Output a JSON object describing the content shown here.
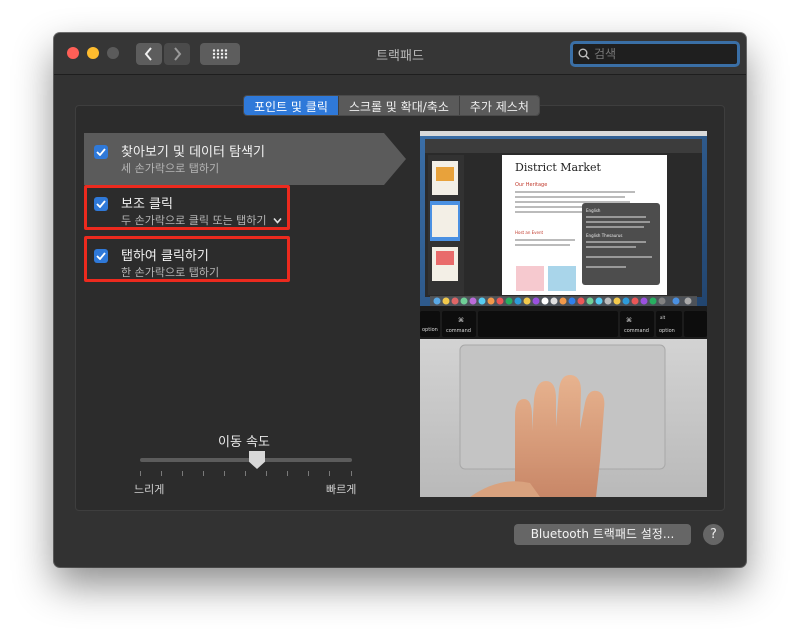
{
  "window": {
    "title": "트랙패드",
    "search_placeholder": "검색"
  },
  "tabs": [
    {
      "label": "포인트 및 클릭",
      "active": true
    },
    {
      "label": "스크롤 및 확대/축소",
      "active": false
    },
    {
      "label": "추가 제스처",
      "active": false
    }
  ],
  "options": [
    {
      "title": "찾아보기 및 데이터 탐색기",
      "subtitle": "세 손가락으로 탭하기",
      "checked": true
    },
    {
      "title": "보조 클릭",
      "subtitle": "두 손가락으로 클릭 또는 탭하기",
      "checked": true,
      "has_dropdown": true
    },
    {
      "title": "탭하여 클릭하기",
      "subtitle": "한 손가락으로 탭하기",
      "checked": true
    }
  ],
  "tracking_speed": {
    "label": "이동 속도",
    "min_label": "느리게",
    "max_label": "빠르게",
    "value_fraction": 0.5
  },
  "preview": {
    "doc_title": "District Market",
    "doc_section1": "Our Heritage",
    "doc_section2": "Host an Event",
    "popup_heading": "English",
    "popup_sub": "English Thesaurus",
    "key_option": "option",
    "key_command": "command",
    "key_cmd_symbol": "⌘",
    "key_alt": "alt"
  },
  "footer": {
    "bluetooth_button": "Bluetooth 트랙패드 설정...",
    "help_button": "?"
  },
  "colors": {
    "accent": "#2f79d9",
    "highlight_outline": "#ec2a1e"
  }
}
